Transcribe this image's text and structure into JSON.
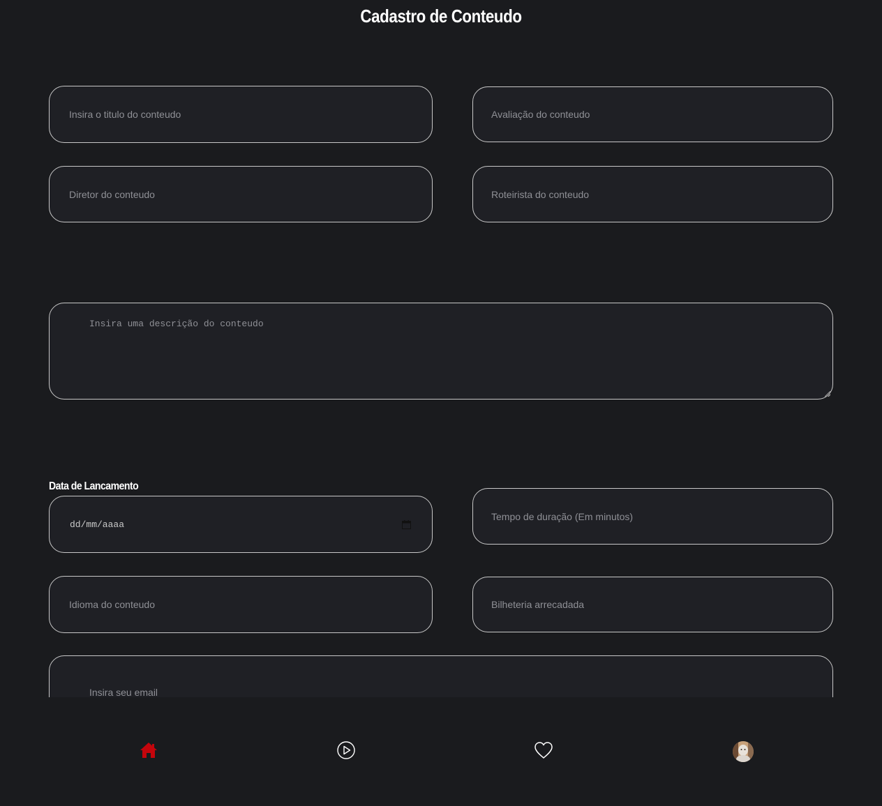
{
  "header": {
    "title": "Cadastro de Conteudo"
  },
  "form": {
    "title_placeholder": "Insira o titulo do conteudo",
    "rating_placeholder": "Avaliação do conteudo",
    "director_placeholder": "Diretor do conteudo",
    "writer_placeholder": "Roteirista do conteudo",
    "description_placeholder": "Insira uma descrição do conteudo",
    "release_date_label": "Data de Lancamento",
    "release_date_placeholder": "dd/mm/aaaa",
    "duration_placeholder": "Tempo de duração (Em minutos)",
    "language_placeholder": "Idioma do conteudo",
    "box_office_placeholder": "Bilheteria arrecadada",
    "email_placeholder": "Insira seu email"
  },
  "nav": {
    "items": [
      {
        "icon": "home-icon",
        "active": true
      },
      {
        "icon": "play-circle-icon",
        "active": false
      },
      {
        "icon": "heart-icon",
        "active": false
      },
      {
        "icon": "avatar",
        "active": false
      }
    ]
  },
  "colors": {
    "background": "#1a1b1e",
    "field_background": "#1f2025",
    "field_border": "#c8c8c8",
    "accent_active": "#c4050c",
    "placeholder": "#8f9096"
  }
}
